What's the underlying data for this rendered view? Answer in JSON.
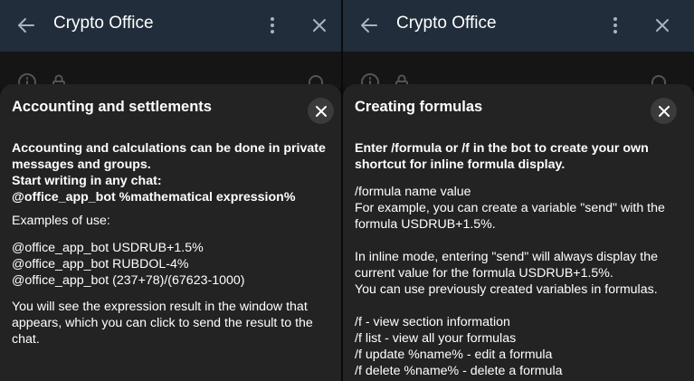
{
  "app": {
    "name": "Crypto Office"
  },
  "colors": {
    "header_bg": "#212d3b",
    "sheet_bg": "#232323",
    "close_circle": "#3b3b3b"
  },
  "icons": {
    "back": "arrow-left-icon",
    "menu": "more-vertical-icon",
    "close": "close-icon"
  },
  "left": {
    "header_title": "Crypto Office",
    "sheet_title": "Accounting and settlements",
    "bold_lines": [
      "Accounting and calculations can be done in private messages and groups.",
      "Start writing in any chat:",
      "@office_app_bot %mathematical expression%"
    ],
    "examples_label": "Examples of use:",
    "examples": [
      "@office_app_bot USDRUB+1.5%",
      "@office_app_bot RUBDOL-4%",
      "@office_app_bot (237+78)/(67623-1000)"
    ],
    "result_text": "You will see the expression result in the window that appears, which you can click to send the result to the chat."
  },
  "right": {
    "header_title": "Crypto Office",
    "sheet_title": "Creating formulas",
    "intro_bold": "Enter /formula or /f in the bot to create your own shortcut for inline formula display.",
    "syntax": "/formula name value",
    "example_text": "For example, you can create a variable \"send\" with the formula USDRUB+1.5%.",
    "inline_text": "In inline mode, entering \"send\" will always display the current value for the formula USDRUB+1.5%.",
    "variables_text": "You can use previously created variables in formulas.",
    "commands": [
      "/f - view section information",
      "/f list - view all your formulas",
      "/f update %name% - edit a formula",
      "/f delete %name% - delete a formula"
    ]
  }
}
